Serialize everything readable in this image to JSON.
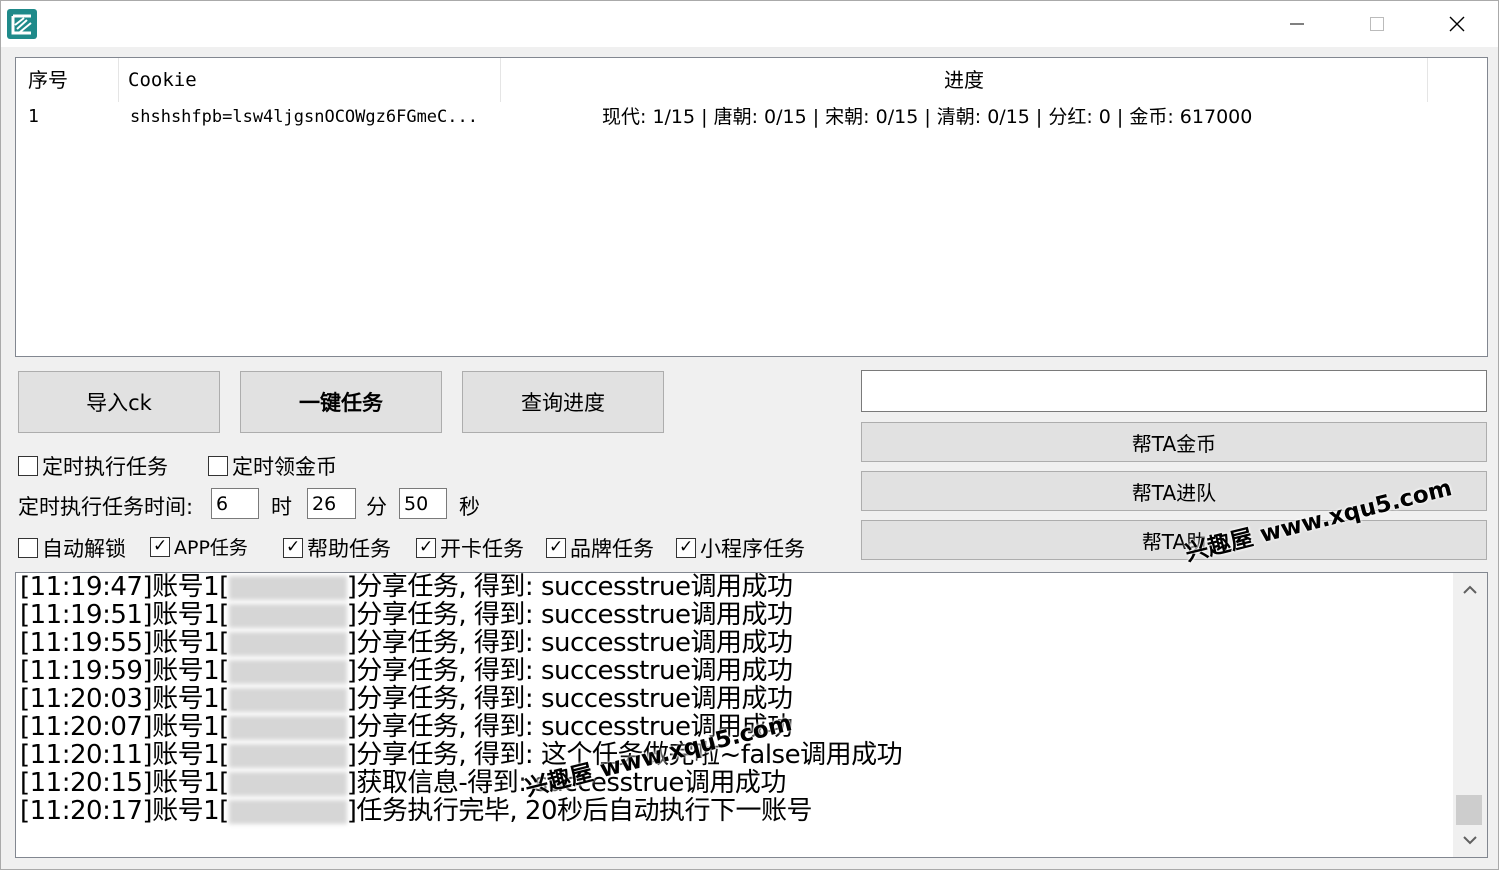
{
  "listview": {
    "headers": {
      "index": "序号",
      "cookie": "Cookie",
      "progress": "进度"
    },
    "rows": [
      {
        "index": "1",
        "cookie": "shshshfpb=lsw4ljgsnOCOWgz6FGmeC...",
        "progress": "现代: 1/15 | 唐朝: 0/15 | 宋朝: 0/15 | 清朝: 0/15 | 分红: 0 | 金币: 617000"
      }
    ]
  },
  "buttons": {
    "import": "导入ck",
    "one_key": "一键任务",
    "query": "查询进度",
    "help_coin": "帮TA金币",
    "help_team": "帮TA进队",
    "help_third": "帮TA助"
  },
  "help_input": {
    "value": ""
  },
  "options": {
    "timed_task": {
      "label": "定时执行任务",
      "checked": false
    },
    "timed_coin": {
      "label": "定时领金币",
      "checked": false
    },
    "auto_unlock": {
      "label": "自动解锁",
      "checked": false
    },
    "app_task": {
      "label": "APP任务",
      "checked": true
    },
    "help_task": {
      "label": "帮助任务",
      "checked": true
    },
    "card_task": {
      "label": "开卡任务",
      "checked": true
    },
    "brand_task": {
      "label": "品牌任务",
      "checked": true
    },
    "mini_task": {
      "label": "小程序任务",
      "checked": true
    }
  },
  "timer": {
    "label": "定时执行任务时间:",
    "hour": "6",
    "hour_unit": "时",
    "minute": "26",
    "minute_unit": "分",
    "second": "50",
    "second_unit": "秒"
  },
  "log": {
    "lines": [
      {
        "time": "[11:19:47]",
        "acct": "账号1[",
        "msg": "]分享任务, 得到:  successtrue调用成功"
      },
      {
        "time": "[11:19:51]",
        "acct": "账号1[",
        "msg": "]分享任务, 得到:  successtrue调用成功"
      },
      {
        "time": "[11:19:55]",
        "acct": "账号1[",
        "msg": "]分享任务, 得到:  successtrue调用成功"
      },
      {
        "time": "[11:19:59]",
        "acct": "账号1[",
        "msg": "]分享任务, 得到:  successtrue调用成功"
      },
      {
        "time": "[11:20:03]",
        "acct": "账号1[",
        "msg": "]分享任务, 得到:  successtrue调用成功"
      },
      {
        "time": "[11:20:07]",
        "acct": "账号1[",
        "msg": "]分享任务, 得到:  successtrue调用成功"
      },
      {
        "time": "[11:20:11]",
        "acct": "账号1[",
        "msg": "]分享任务, 得到:  这个任务做完啦~false调用成功"
      },
      {
        "time": "[11:20:15]",
        "acct": "账号1[",
        "msg": "]获取信息-得到:  successtrue调用成功"
      },
      {
        "time": "[11:20:17]",
        "acct": "账号1[",
        "msg": "]任务执行完毕, 20秒后自动执行下一账号"
      }
    ]
  },
  "watermarks": [
    "兴趣屋 www.xqu5.com",
    "兴趣屋 www.xqu5.com"
  ]
}
